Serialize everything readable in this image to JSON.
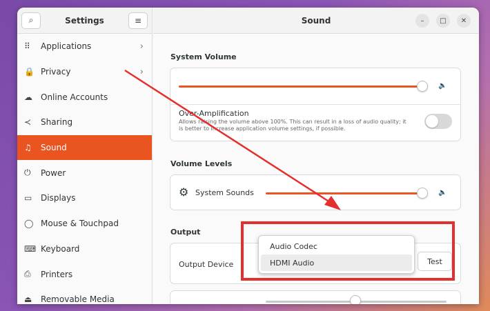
{
  "sidebar": {
    "title": "Settings",
    "search_icon": "search-icon",
    "menu_icon": "hamburger-icon",
    "items": [
      {
        "label": "Applications",
        "icon": "⠿",
        "chevron": true
      },
      {
        "label": "Privacy",
        "icon": "🔒",
        "chevron": true
      },
      {
        "label": "Online Accounts",
        "icon": "☁",
        "chevron": false
      },
      {
        "label": "Sharing",
        "icon": "≺",
        "chevron": false
      },
      {
        "label": "Sound",
        "icon": "♫",
        "chevron": false,
        "active": true
      },
      {
        "label": "Power",
        "icon": "⏻",
        "chevron": false
      },
      {
        "label": "Displays",
        "icon": "▭",
        "chevron": false
      },
      {
        "label": "Mouse & Touchpad",
        "icon": "◯",
        "chevron": false
      },
      {
        "label": "Keyboard",
        "icon": "⌨",
        "chevron": false
      },
      {
        "label": "Printers",
        "icon": "⎙",
        "chevron": false
      },
      {
        "label": "Removable Media",
        "icon": "⏏",
        "chevron": false
      }
    ]
  },
  "main": {
    "title": "Sound",
    "system_volume": {
      "heading": "System Volume",
      "level": 0.98,
      "over_amp_title": "Over-Amplification",
      "over_amp_desc": "Allows raising the volume above 100%. This can result in a loss of audio quality; it is better to increase application volume settings, if possible.",
      "over_amp_enabled": false
    },
    "volume_levels": {
      "heading": "Volume Levels",
      "system_sounds_label": "System Sounds",
      "level": 0.98
    },
    "output": {
      "heading": "Output",
      "device_label": "Output Device",
      "test_label": "Test",
      "options": [
        "Audio Codec",
        "HDMI Audio"
      ],
      "selected": "HDMI Audio"
    }
  },
  "colors": {
    "accent": "#e95420",
    "annotation": "#e52e2e"
  }
}
